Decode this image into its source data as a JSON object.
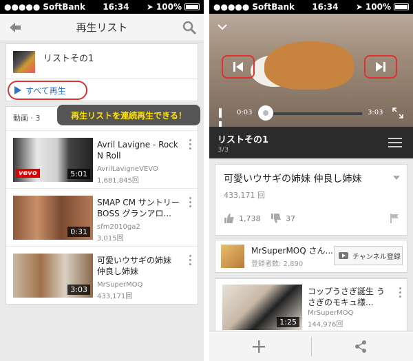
{
  "status": {
    "carrier": "SoftBank",
    "time": "16:34",
    "battery": "100%"
  },
  "left": {
    "header": {
      "title": "再生リスト"
    },
    "playlist": {
      "name": "リストその1",
      "play_all": "すべて再生"
    },
    "videos": {
      "header_label": "動画",
      "count": "3",
      "callout": "再生リストを連続再生できる！",
      "items": [
        {
          "title": "Avril Lavigne - Rock N Roll",
          "channel": "AvrilLavigneVEVO",
          "views": "1,681,845回",
          "duration": "5:01",
          "badge": "vevo"
        },
        {
          "title": "SMAP CM サントリー BOSS グランアロ...",
          "channel": "sfm2010ga2",
          "views": "3,015回",
          "duration": "0:31"
        },
        {
          "title": "可愛いウサギの姉妹 仲良し姉妹",
          "channel": "MrSuperMOQ",
          "views": "433,171回",
          "duration": "3:03"
        }
      ]
    }
  },
  "right": {
    "player": {
      "current_time": "0:03",
      "total_time": "3:03",
      "progress": 0.0164
    },
    "playlist_bar": {
      "name": "リストその1",
      "index": "3/3"
    },
    "video": {
      "title": "可愛いウサギの姉妹 仲良し姉妹",
      "views": "433,171 回",
      "likes": "1,738",
      "dislikes": "37"
    },
    "channel": {
      "name": "MrSuperMOQ さん...",
      "subscribers": "登録者数: 2,890",
      "subscribe": "チャンネル登録"
    },
    "related": {
      "title": "コップうさぎ誕生 うさぎのモキュ様...",
      "channel": "MrSuperMOQ",
      "views": "144,976回",
      "duration": "1:25"
    }
  },
  "colors": {
    "accent_blue": "#2a72c8",
    "highlight_red": "#e03030",
    "callout_text": "#ffe000"
  },
  "icons": {
    "back": "back-arrow-icon",
    "search": "search-icon",
    "play": "play-icon",
    "more": "more-vertical-icon",
    "collapse": "chevron-down-icon",
    "prev": "skip-previous-icon",
    "next": "skip-next-icon",
    "pause": "pause-icon",
    "fullscreen": "fullscreen-icon",
    "queue": "playlist-queue-icon",
    "like": "thumbs-up-icon",
    "dislike": "thumbs-down-icon",
    "flag": "flag-icon",
    "add": "plus-icon",
    "share": "share-icon"
  }
}
